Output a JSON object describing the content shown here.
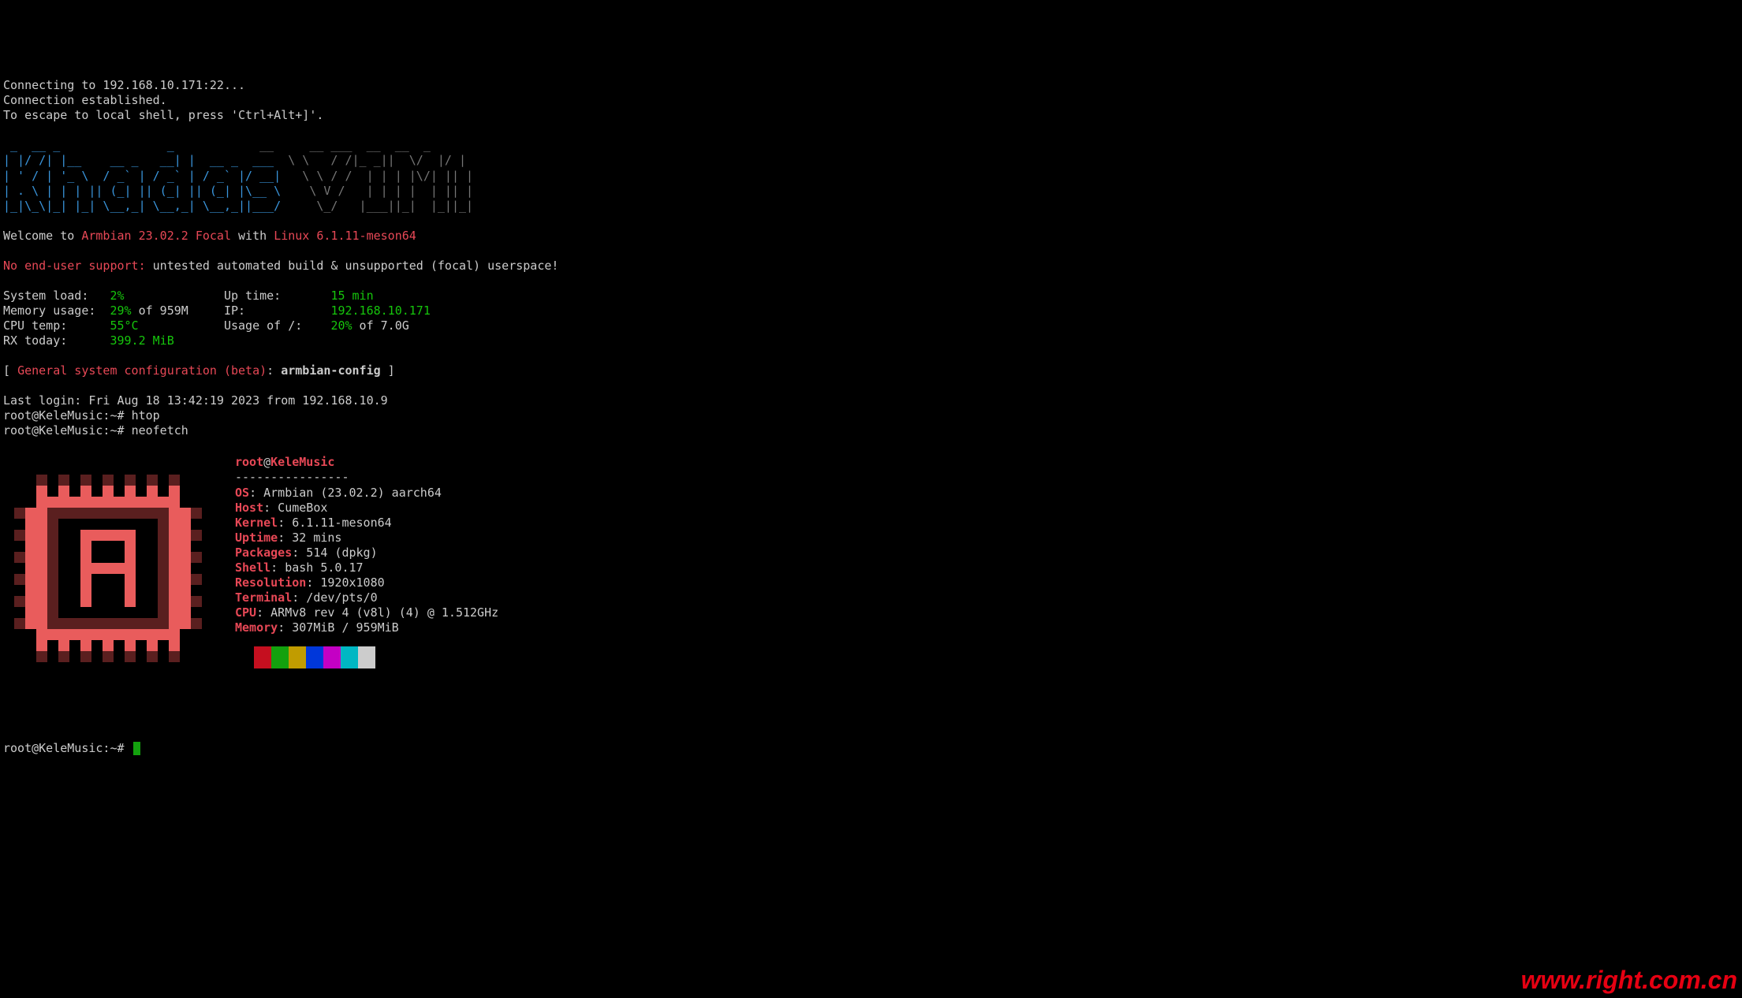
{
  "conn": {
    "line1": "Connecting to 192.168.10.171:22...",
    "line2": "Connection established.",
    "line3": "To escape to local shell, press 'Ctrl+Alt+]'."
  },
  "banner": {
    "l1a": " _  __ _               _           ",
    "l1b": " __     __ ___  __  __  _ ",
    "l2a": "| |/ /| |__    __ _   __| |  __ _  ___ ",
    "l2b": " \\ \\   / /|_ _||  \\/  |/ |",
    "l3a": "| ' / | '_ \\  / _` | / _` | / _` |/ __| ",
    "l3b": "  \\ \\ / /  | | | |\\/| || |",
    "l4a": "| . \\ | | | || (_| || (_| || (_| |\\__ \\ ",
    "l4b": "   \\ V /   | | | |  | || |",
    "l5a": "|_|\\_\\|_| |_| \\__,_| \\__,_| \\__,_||___/ ",
    "l5b": "    \\_/   |___||_|  |_||_|"
  },
  "welcome": {
    "pre": "Welcome to ",
    "os": "Armbian 23.02.2 Focal",
    "mid": " with ",
    "kernel": "Linux 6.1.11-meson64"
  },
  "support": {
    "label": "No end-user support:",
    "text": " untested automated build & unsupported (focal) userspace!"
  },
  "stats": {
    "load_lbl": "System load:   ",
    "load_val": "2%",
    "uptime_lbl": "Up time:       ",
    "uptime_val": "15 min",
    "mem_lbl": "Memory usage:  ",
    "mem_val": "29%",
    "mem_suffix": " of 959M",
    "ip_lbl": "IP:            ",
    "ip_val": "192.168.10.171",
    "cputemp_lbl": "CPU temp:      ",
    "cputemp_val": "55°C",
    "usage_lbl": "Usage of /:    ",
    "usage_val": "20%",
    "usage_suffix": " of 7.0G",
    "rx_lbl": "RX today:      ",
    "rx_val": "399.2 MiB"
  },
  "config": {
    "open": "[ ",
    "label": "General system configuration (beta)",
    "sep": ": ",
    "cmd": "armbian-config",
    "close": " ]"
  },
  "lastlogin": "Last login: Fri Aug 18 13:42:19 2023 from 192.168.10.9",
  "prompts": {
    "p1": "root@KeleMusic:~# ",
    "c1": "htop",
    "p2": "root@KeleMusic:~# ",
    "c2": "neofetch",
    "p3": "root@KeleMusic:~# "
  },
  "nf": {
    "user": "root",
    "at": "@",
    "host": "KeleMusic",
    "dash": "----------------",
    "os_k": "OS",
    "os_v": ": Armbian (23.02.2) aarch64",
    "host_k": "Host",
    "host_v": ": CumeBox",
    "kern_k": "Kernel",
    "kern_v": ": 6.1.11-meson64",
    "up_k": "Uptime",
    "up_v": ": 32 mins",
    "pkg_k": "Packages",
    "pkg_v": ": 514 (dpkg)",
    "sh_k": "Shell",
    "sh_v": ": bash 5.0.17",
    "res_k": "Resolution",
    "res_v": ": 1920x1080",
    "term_k": "Terminal",
    "term_v": ": /dev/pts/0",
    "cpu_k": "CPU",
    "cpu_v": ": ARMv8 rev 4 (v8l) (4) @ 1.512GHz",
    "mem_k": "Memory",
    "mem_v": ": 307MiB / 959MiB"
  },
  "watermark": "www.right.com.cn"
}
